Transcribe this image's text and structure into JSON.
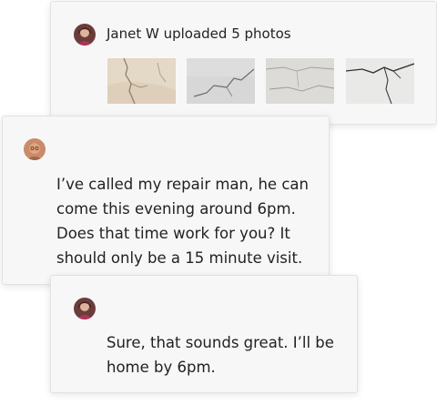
{
  "upload_card": {
    "author_avatar_icon": "avatar-janet",
    "text": "Janet W uploaded 5 photos",
    "photos": [
      "wall-crack-photo-1",
      "wall-crack-photo-2",
      "wall-crack-photo-3",
      "wall-crack-photo-4"
    ]
  },
  "reply_card": {
    "author_avatar_icon": "avatar-repairman",
    "text": "I’ve called my repair man, he can come this evening around 6pm. Does that time work for you? It should only be a 15 minute visit."
  },
  "response_card": {
    "author_avatar_icon": "avatar-janet",
    "text": "Sure, that sounds great. I’ll be home by 6pm."
  }
}
